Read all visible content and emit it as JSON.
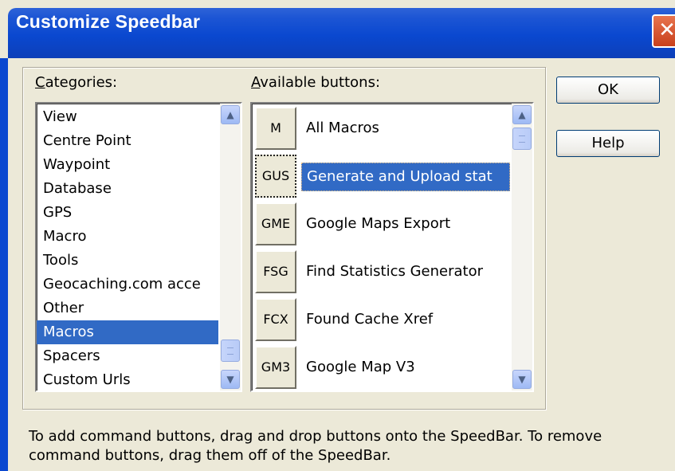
{
  "window": {
    "title": "Customize Speedbar",
    "close_glyph": "✕"
  },
  "categories": {
    "label_accel": "C",
    "label_rest": "ategories:",
    "items": [
      "View",
      "Centre Point",
      "Waypoint",
      "Database",
      "GPS",
      "Macro",
      "Tools",
      "Geocaching.com acce",
      "Other",
      "Macros",
      "Spacers",
      "Custom Urls"
    ],
    "selected": "Macros"
  },
  "available": {
    "label_accel": "A",
    "label_rest": "vailable buttons:",
    "items": [
      {
        "code": "M",
        "label": "All Macros"
      },
      {
        "code": "GUS",
        "label": "Generate and Upload stat"
      },
      {
        "code": "GME",
        "label": "Google Maps Export"
      },
      {
        "code": "FSG",
        "label": "Find Statistics Generator"
      },
      {
        "code": "FCX",
        "label": "Found Cache Xref"
      },
      {
        "code": "GM3",
        "label": "Google Map V3"
      }
    ],
    "selected": "GUS"
  },
  "buttons": {
    "ok": "OK",
    "help": "Help"
  },
  "hint_text": "To add command buttons, drag and drop buttons onto the SpeedBar. To remove command buttons, drag them off of the SpeedBar.",
  "icons": {
    "scroll_up": "scroll-up-icon",
    "scroll_down": "scroll-down-icon",
    "close": "close-icon"
  },
  "colors": {
    "title_bar": "#0a48d0",
    "selection": "#316ac5",
    "face": "#ece9d8"
  }
}
